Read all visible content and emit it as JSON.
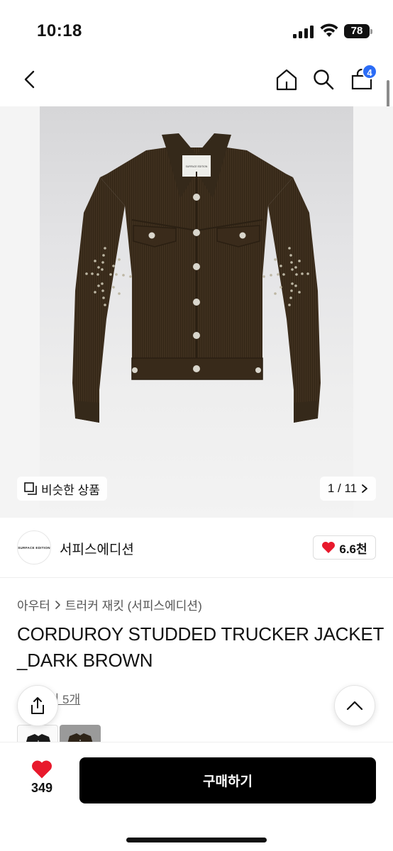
{
  "status_bar": {
    "time": "10:18",
    "battery": "78"
  },
  "nav": {
    "cart_count": "4"
  },
  "gallery": {
    "similar_label": "비슷한 상품",
    "pager": "1 / 11",
    "brand_tag": "SURFACE EDITION"
  },
  "brand": {
    "logo_text": "SURFACE EDITION",
    "name": "서피스에디션",
    "likes": "6.6천"
  },
  "breadcrumb": {
    "category": "아우터",
    "subcategory": "트러커 재킷 (서피스에디션)"
  },
  "product": {
    "title_line1": "CORDUROY STUDDED TRUCKER JACKET",
    "title_line2": "_DARK BROWN",
    "reviews": "후기 5개"
  },
  "bottom": {
    "wish_count": "349",
    "buy_label": "구매하기"
  },
  "colors": {
    "accent_badge": "#2b6cf6",
    "heart": "#e8192c",
    "buy_button": "#000000"
  }
}
